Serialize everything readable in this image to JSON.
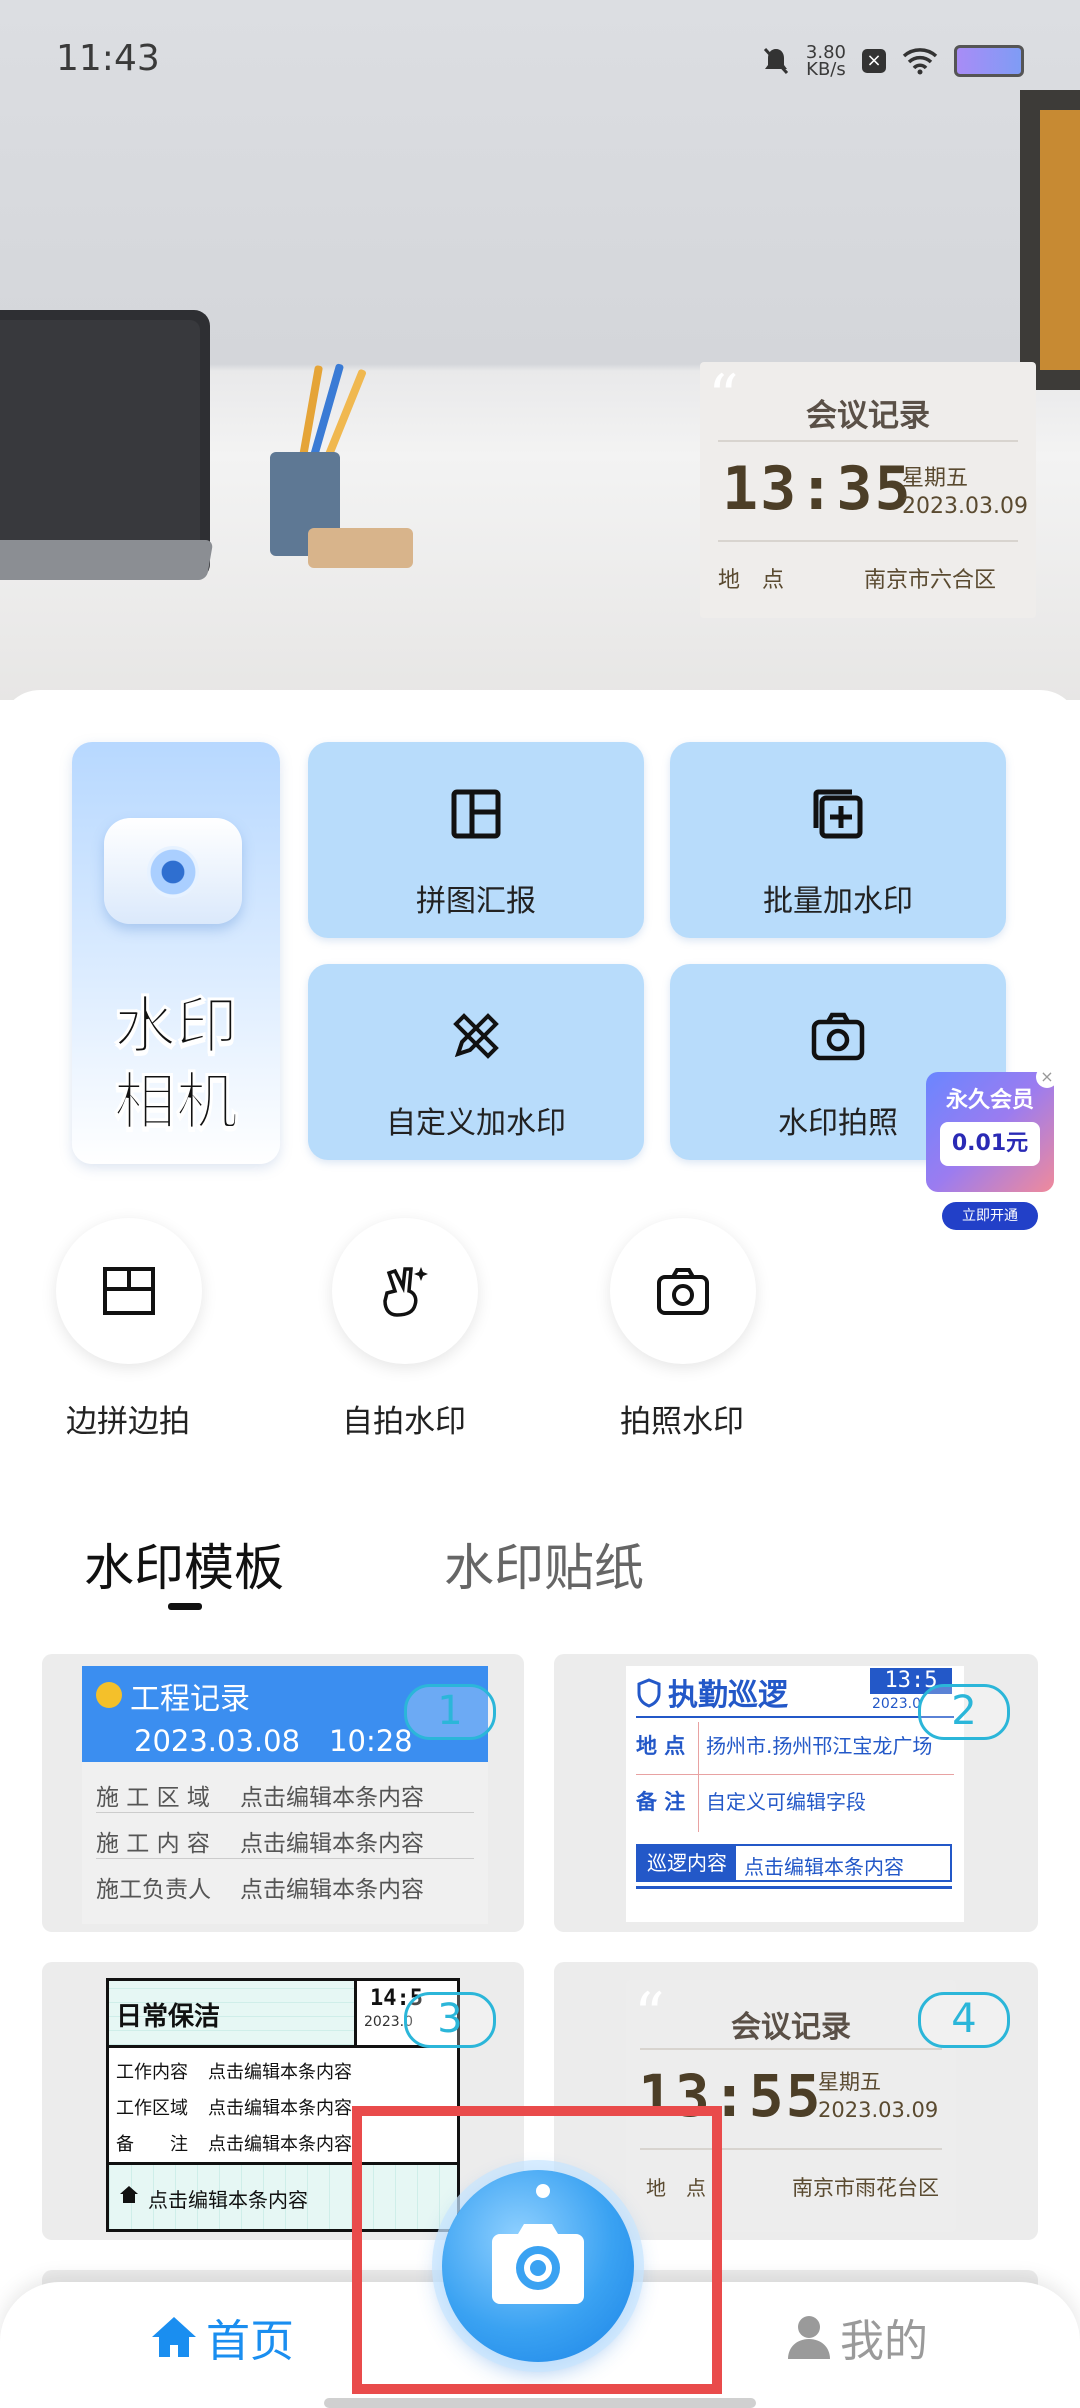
{
  "status_bar": {
    "time": "11:43",
    "net_speed": "3.80",
    "net_unit": "KB/s"
  },
  "hero_watermark": {
    "title": "会议记录",
    "time": "13:35",
    "weekday": "星期五",
    "date": "2023.03.09",
    "location_label": "地　点",
    "location_value": "南京市六合区"
  },
  "featured": {
    "line1": "水印",
    "line2": "相机"
  },
  "tiles": [
    {
      "label": "拼图汇报",
      "icon": "layout-icon"
    },
    {
      "label": "批量加水印",
      "icon": "batch-add-icon"
    },
    {
      "label": "自定义加水印",
      "icon": "pen-ruler-icon"
    },
    {
      "label": "水印拍照",
      "icon": "camera-icon"
    }
  ],
  "vip_popup": {
    "title": "永久会员",
    "price": "0.01元",
    "button": "立即开通"
  },
  "quick_actions": [
    {
      "label": "边拼边拍",
      "icon": "split-layout-icon"
    },
    {
      "label": "自拍水印",
      "icon": "peace-hand-icon"
    },
    {
      "label": "拍照水印",
      "icon": "camera-icon"
    }
  ],
  "section_tabs": [
    {
      "label": "水印模板",
      "active": true
    },
    {
      "label": "水印贴纸",
      "active": false
    }
  ],
  "templates": {
    "t1": {
      "number": "1",
      "title": "工程记录",
      "datetime": "2023.03.08　10:28",
      "rows": [
        {
          "label": "施 工 区 域",
          "value": "点击编辑本条内容"
        },
        {
          "label": "施 工 内 容",
          "value": "点击编辑本条内容"
        },
        {
          "label": "施工负责人",
          "value": "点击编辑本条内容"
        }
      ]
    },
    "t2": {
      "number": "2",
      "title": "执勤巡逻",
      "time": "13:5",
      "date": "2023.0",
      "rows": [
        {
          "label": "地 点",
          "value": "扬州市.扬州邗江宝龙广场"
        },
        {
          "label": "备 注",
          "value": "自定义可编辑字段"
        }
      ],
      "footer_label": "巡逻内容",
      "footer_value": "点击编辑本条内容"
    },
    "t3": {
      "number": "3",
      "title": "日常保洁",
      "time": "14:5",
      "date": "2023.0",
      "rows": [
        {
          "label": "工作内容",
          "value": "点击编辑本条内容"
        },
        {
          "label": "工作区域",
          "value": "点击编辑本条内容"
        },
        {
          "label": "备　　注",
          "value": "点击编辑本条内容"
        }
      ],
      "footer": "点击编辑本条内容"
    },
    "t4": {
      "number": "4",
      "title": "会议记录",
      "time": "13:55",
      "weekday": "星期五",
      "date": "2023.03.09",
      "location_label": "地　点",
      "location_value": "南京市雨花台区"
    }
  },
  "bottom_nav": {
    "home": "首页",
    "me": "我的"
  }
}
